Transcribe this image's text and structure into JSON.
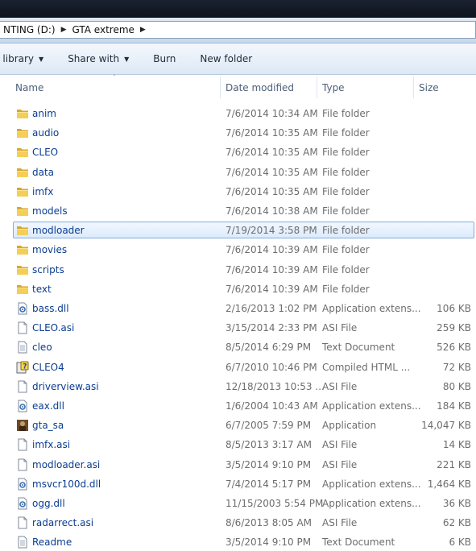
{
  "address": {
    "crumbs": [
      "NTING (D:)",
      "GTA extreme"
    ]
  },
  "toolbar": {
    "include_label": "n library",
    "share_label": "Share with",
    "burn_label": "Burn",
    "newfolder_label": "New folder"
  },
  "columns": {
    "name": "Name",
    "date": "Date modified",
    "type": "Type",
    "size": "Size"
  },
  "files": [
    {
      "name": "anim",
      "date": "7/6/2014 10:34 AM",
      "type": "File folder",
      "size": "",
      "icon": "folder-icon"
    },
    {
      "name": "audio",
      "date": "7/6/2014 10:35 AM",
      "type": "File folder",
      "size": "",
      "icon": "folder-icon"
    },
    {
      "name": "CLEO",
      "date": "7/6/2014 10:35 AM",
      "type": "File folder",
      "size": "",
      "icon": "folder-icon"
    },
    {
      "name": "data",
      "date": "7/6/2014 10:35 AM",
      "type": "File folder",
      "size": "",
      "icon": "folder-icon"
    },
    {
      "name": "imfx",
      "date": "7/6/2014 10:35 AM",
      "type": "File folder",
      "size": "",
      "icon": "folder-icon"
    },
    {
      "name": "models",
      "date": "7/6/2014 10:38 AM",
      "type": "File folder",
      "size": "",
      "icon": "folder-icon"
    },
    {
      "name": "modloader",
      "date": "7/19/2014 3:58 PM",
      "type": "File folder",
      "size": "",
      "icon": "folder-icon",
      "selected": true
    },
    {
      "name": "movies",
      "date": "7/6/2014 10:39 AM",
      "type": "File folder",
      "size": "",
      "icon": "folder-icon"
    },
    {
      "name": "scripts",
      "date": "7/6/2014 10:39 AM",
      "type": "File folder",
      "size": "",
      "icon": "folder-icon"
    },
    {
      "name": "text",
      "date": "7/6/2014 10:39 AM",
      "type": "File folder",
      "size": "",
      "icon": "folder-icon"
    },
    {
      "name": "bass.dll",
      "date": "2/16/2013 1:02 PM",
      "type": "Application extens...",
      "size": "106 KB",
      "icon": "dll-icon"
    },
    {
      "name": "CLEO.asi",
      "date": "3/15/2014 2:33 PM",
      "type": "ASI File",
      "size": "259 KB",
      "icon": "blank-file-icon"
    },
    {
      "name": "cleo",
      "date": "8/5/2014 6:29 PM",
      "type": "Text Document",
      "size": "526 KB",
      "icon": "text-file-icon"
    },
    {
      "name": "CLEO4",
      "date": "6/7/2010 10:46 PM",
      "type": "Compiled HTML ...",
      "size": "72 KB",
      "icon": "chm-help-icon"
    },
    {
      "name": "driverview.asi",
      "date": "12/18/2013 10:53 ...",
      "type": "ASI File",
      "size": "80 KB",
      "icon": "blank-file-icon"
    },
    {
      "name": "eax.dll",
      "date": "1/6/2004 10:43 AM",
      "type": "Application extens...",
      "size": "184 KB",
      "icon": "dll-icon"
    },
    {
      "name": "gta_sa",
      "date": "6/7/2005 7:59 PM",
      "type": "Application",
      "size": "14,047 KB",
      "icon": "gta-app-icon"
    },
    {
      "name": "imfx.asi",
      "date": "8/5/2013 3:17 AM",
      "type": "ASI File",
      "size": "14 KB",
      "icon": "blank-file-icon"
    },
    {
      "name": "modloader.asi",
      "date": "3/5/2014 9:10 PM",
      "type": "ASI File",
      "size": "221 KB",
      "icon": "blank-file-icon"
    },
    {
      "name": "msvcr100d.dll",
      "date": "7/4/2014 5:17 PM",
      "type": "Application extens...",
      "size": "1,464 KB",
      "icon": "dll-icon"
    },
    {
      "name": "ogg.dll",
      "date": "11/15/2003 5:54 PM",
      "type": "Application extens...",
      "size": "36 KB",
      "icon": "dll-icon"
    },
    {
      "name": "radarrect.asi",
      "date": "8/6/2013 8:05 AM",
      "type": "ASI File",
      "size": "62 KB",
      "icon": "blank-file-icon"
    },
    {
      "name": "Readme",
      "date": "3/5/2014 9:10 PM",
      "type": "Text Document",
      "size": "6 KB",
      "icon": "text-file-icon"
    }
  ]
}
